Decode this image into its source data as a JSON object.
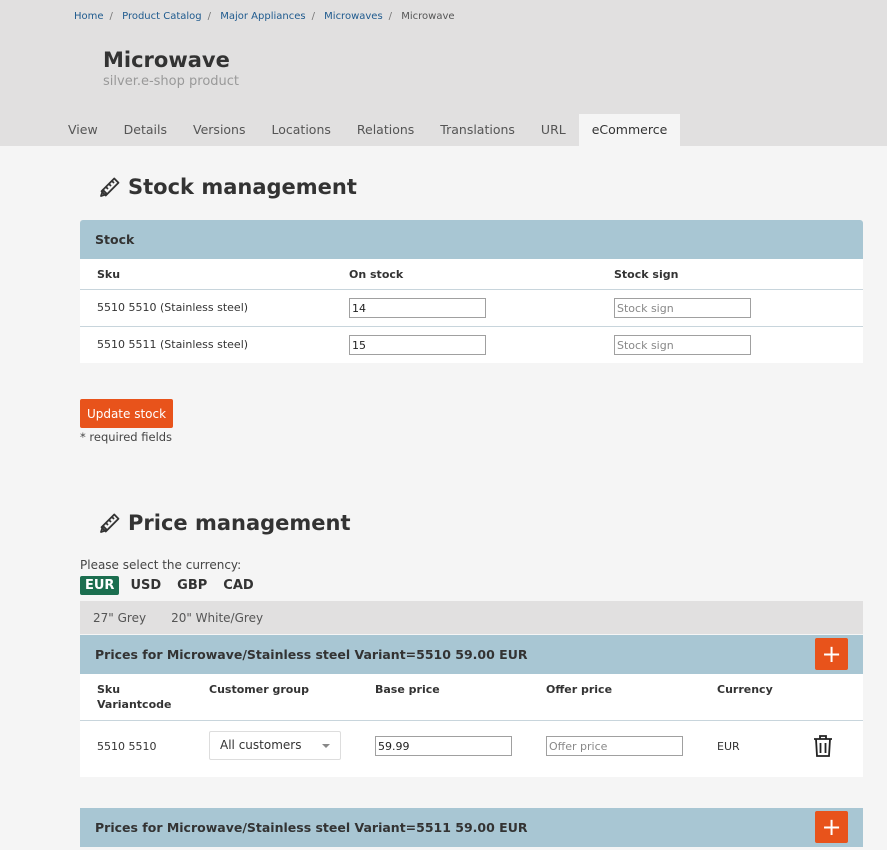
{
  "breadcrumb": [
    "Home",
    "Product Catalog",
    "Major Appliances",
    "Microwaves",
    "Microwave"
  ],
  "page": {
    "title": "Microwave",
    "subtitle": "silver.e-shop product"
  },
  "tabs": [
    {
      "label": "View",
      "active": false
    },
    {
      "label": "Details",
      "active": false
    },
    {
      "label": "Versions",
      "active": false
    },
    {
      "label": "Locations",
      "active": false
    },
    {
      "label": "Relations",
      "active": false
    },
    {
      "label": "Translations",
      "active": false
    },
    {
      "label": "URL",
      "active": false
    },
    {
      "label": "eCommerce",
      "active": true
    }
  ],
  "stock": {
    "section_title": "Stock management",
    "panel_title": "Stock",
    "columns": [
      "Sku",
      "On stock",
      "Stock sign"
    ],
    "rows": [
      {
        "sku": "5510 5510 (Stainless steel)",
        "on_stock": "14",
        "stock_sign_placeholder": "Stock sign"
      },
      {
        "sku": "5510 5511 (Stainless steel)",
        "on_stock": "15",
        "stock_sign_placeholder": "Stock sign"
      }
    ],
    "update_button": "Update stock",
    "required_note": "* required fields"
  },
  "price": {
    "section_title": "Price management",
    "currency_label": "Please select the currency:",
    "currencies": [
      "EUR",
      "USD",
      "GBP",
      "CAD"
    ],
    "active_currency": "EUR",
    "variants": [
      "27\" Grey",
      "20\" White/Grey"
    ],
    "blocks": [
      {
        "title": "Prices for Microwave/Stainless steel Variant=5510 59.00 EUR",
        "columns": {
          "sku": "Sku",
          "variantcode": "Variantcode",
          "customer_group": "Customer group",
          "base_price": "Base price",
          "offer_price": "Offer price",
          "currency": "Currency"
        },
        "row": {
          "sku": "5510 5510",
          "customer_group": "All customers",
          "base_price": "59.99",
          "offer_price_placeholder": "Offer price",
          "currency": "EUR"
        }
      },
      {
        "title": "Prices for Microwave/Stainless steel Variant=5511 59.00 EUR"
      }
    ]
  },
  "colors": {
    "accent": "#e8531b",
    "panel": "#a8c6d3",
    "active_currency": "#1b6e4f",
    "header_bg": "#e1e0e0"
  },
  "icons": {
    "section": "ruler-pencil-icon",
    "add": "plus-icon",
    "delete": "trash-icon"
  }
}
